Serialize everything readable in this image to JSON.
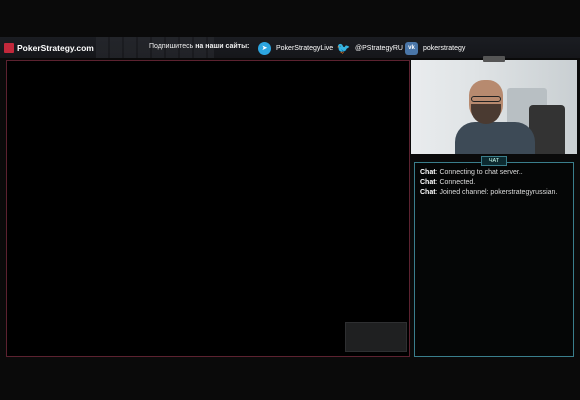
{
  "header": {
    "brand": "PokerStrategy.com",
    "subscribe_prefix": "Подпишитесь",
    "subscribe_bold": "на наши сайты:",
    "social": [
      {
        "icon": "telegram-icon",
        "label": "PokerStrategyLive"
      },
      {
        "icon": "twitter-icon",
        "label": "@PStrategyRU"
      },
      {
        "icon": "vk-icon",
        "label": "pokerstrategy"
      }
    ]
  },
  "chat": {
    "tab_label": "ЧАТ",
    "messages": [
      {
        "author": "Chat",
        "text": "Connecting to chat server.."
      },
      {
        "author": "Chat",
        "text": "Connected."
      },
      {
        "author": "Chat",
        "text": "Joined channel: pokerstrategyrussian."
      }
    ]
  },
  "colors": {
    "brand_red": "#c2283b",
    "chat_border": "#3a7e8c",
    "telegram": "#2ca5e0",
    "twitter": "#1da1f2",
    "vk": "#4a76a8"
  }
}
